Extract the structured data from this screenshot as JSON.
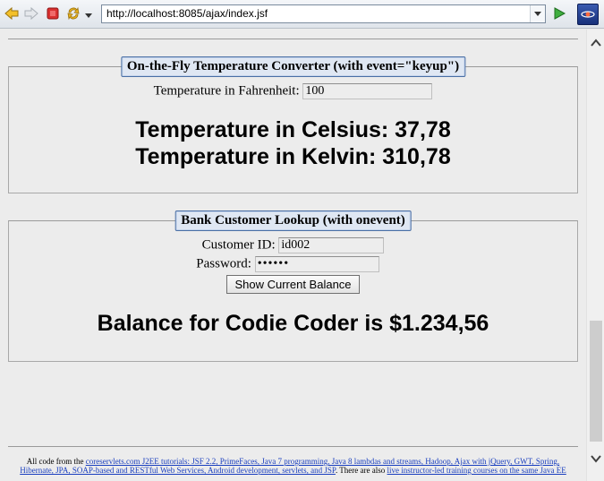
{
  "browser": {
    "url": "http://localhost:8085/ajax/index.jsf"
  },
  "temp_panel": {
    "legend": "On-the-Fly Temperature Converter (with event=\"keyup\")",
    "fahrenheit_label": "Temperature in Fahrenheit:",
    "fahrenheit_value": "100",
    "celsius_text": "Temperature in Celsius: 37,78",
    "kelvin_text": "Temperature in Kelvin: 310,78"
  },
  "bank_panel": {
    "legend": "Bank Customer Lookup (with onevent)",
    "customer_id_label": "Customer ID:",
    "customer_id_value": "id002",
    "password_label": "Password:",
    "password_value": "••••••",
    "button_label": "Show Current Balance",
    "balance_text": "Balance for Codie Coder is $1.234,56"
  },
  "footer": {
    "intro": "All code from the ",
    "link1": "coreservlets.com J2EE tutorials: JSF 2.2, PrimeFaces, Java 7 programming, Java 8 lambdas and streams, Hadoop, Ajax with jQuery, GWT, Spring, Hibernate, JPA, SOAP-based and RESTful Web Services, Android development, servlets, and JSP",
    "mid": ". There are also ",
    "link2": "live instructor-led training courses on the same Java EE"
  },
  "colors": {
    "legend_border": "#4a6fa5",
    "legend_bg": "#dfe7f3",
    "link": "#1a3fbf",
    "page_bg": "#ececec"
  }
}
